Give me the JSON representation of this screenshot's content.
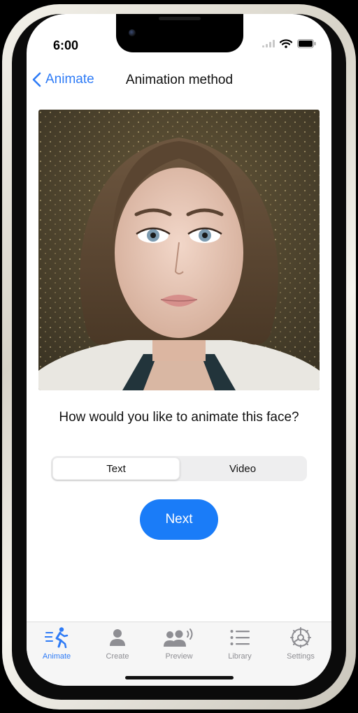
{
  "status_bar": {
    "time": "6:00"
  },
  "nav": {
    "back_label": "Animate",
    "title": "Animation method"
  },
  "main": {
    "question": "How would you like to animate this face?",
    "segments": [
      {
        "label": "Text",
        "selected": true
      },
      {
        "label": "Video",
        "selected": false
      }
    ],
    "next_label": "Next"
  },
  "tab_bar": {
    "items": [
      {
        "label": "Animate",
        "icon": "run-icon",
        "active": true
      },
      {
        "label": "Create",
        "icon": "person-icon",
        "active": false
      },
      {
        "label": "Preview",
        "icon": "people-wave-icon",
        "active": false
      },
      {
        "label": "Library",
        "icon": "list-icon",
        "active": false
      },
      {
        "label": "Settings",
        "icon": "gear-icon",
        "active": false
      }
    ]
  },
  "colors": {
    "accent": "#1a7cf8",
    "inactive": "#8e8e93"
  }
}
